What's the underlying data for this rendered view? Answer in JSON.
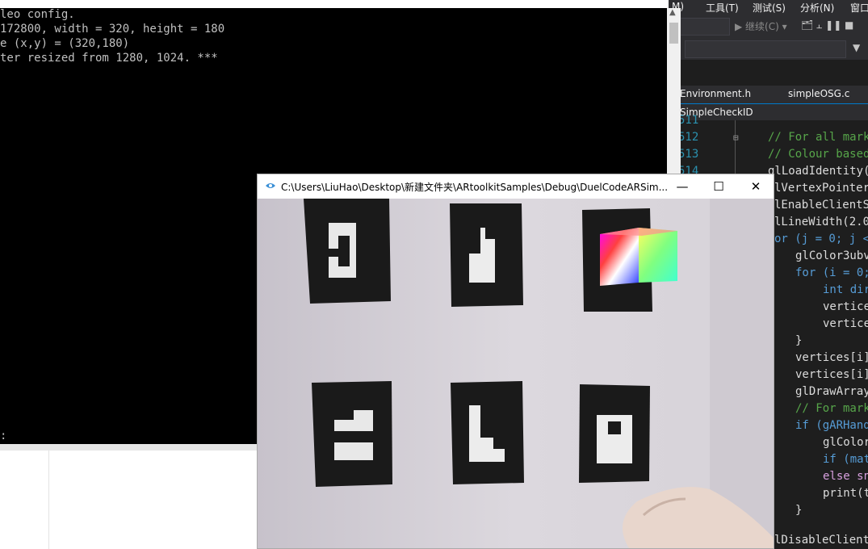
{
  "console": {
    "lines": [
      "leo config.",
      "172800, width = 320, height = 180",
      "e (x,y) = (320,180)",
      "ter resized from 1280, 1024. ***",
      ":"
    ]
  },
  "vs": {
    "menu": [
      "M)",
      "工具(T)",
      "测试(S)",
      "分析(N)",
      "窗口"
    ],
    "toolbar": {
      "continue_label": "继续(C)",
      "icons": "🗂 ⫠  ❚❚ ■"
    },
    "filter_icon": "filter-icon",
    "tabs": [
      "Environment.h",
      "simpleOSG.c"
    ],
    "nav_label": "SimpleCheckID",
    "line_numbers": [
      "511",
      "512",
      "513",
      "514"
    ],
    "code": [
      "// For all mark",
      "// Colour based",
      "glLoadIdentity(",
      "lVertexPointer",
      "lEnableClientS",
      "lLineWidth(2.0",
      "or (j = 0; j <",
      "glColor3ubv",
      "for (i = 0;",
      "int dir",
      "vertice",
      "vertice",
      "}",
      "vertices[i]",
      "vertices[i]",
      "glDrawArray",
      "// For mark",
      "if (gARHand",
      "glColor",
      "if (mat",
      "else sn",
      "print(t",
      "}",
      "lDisableClient"
    ]
  },
  "ar_window": {
    "title": "C:\\Users\\LiuHao\\Desktop\\新建文件夹\\ARtoolkitSamples\\Debug\\DuelCodeARSim...",
    "minimize": "—",
    "maximize": "☐",
    "close": "✕"
  }
}
